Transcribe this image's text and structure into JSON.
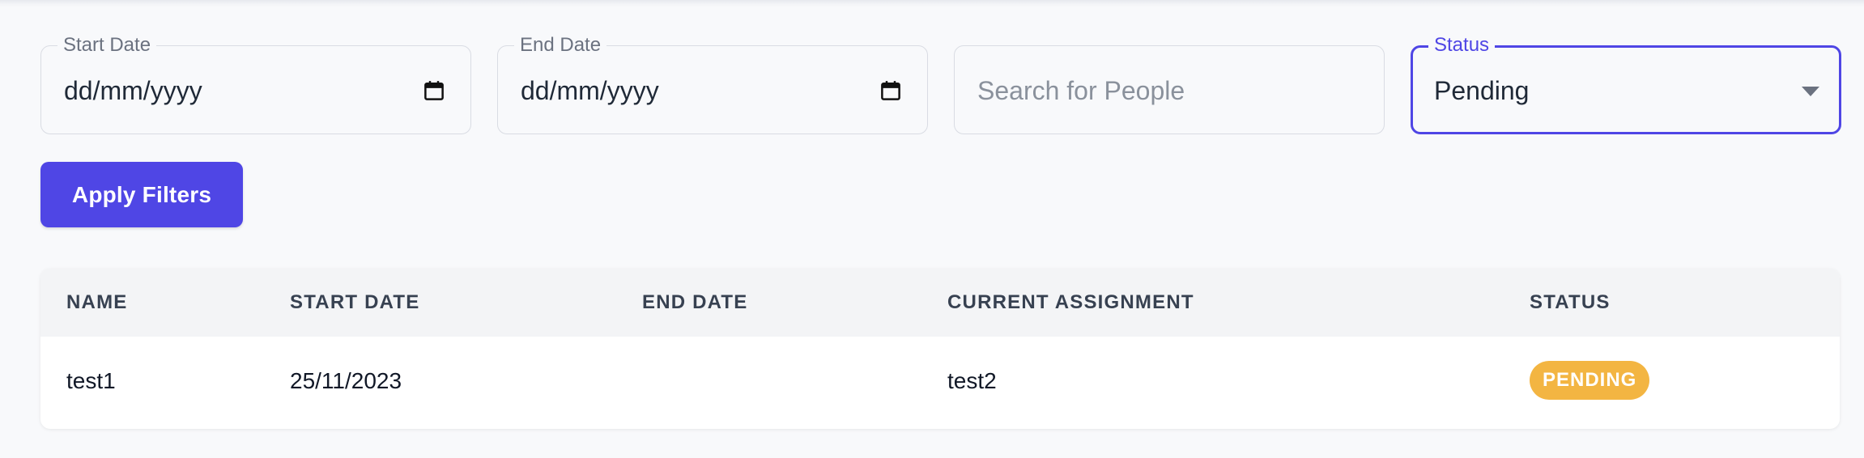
{
  "filters": {
    "start_date": {
      "label": "Start Date",
      "value": "dd/mm/yyyy"
    },
    "end_date": {
      "label": "End Date",
      "value": "dd/mm/yyyy"
    },
    "search": {
      "placeholder": "Search for People"
    },
    "status": {
      "label": "Status",
      "value": "Pending"
    }
  },
  "apply_button": {
    "label": "Apply Filters"
  },
  "table": {
    "columns": [
      "NAME",
      "START DATE",
      "END DATE",
      "CURRENT ASSIGNMENT",
      "STATUS"
    ],
    "rows": [
      {
        "name": "test1",
        "start_date": "25/11/2023",
        "end_date": "",
        "assignment": "test2",
        "status": "PENDING"
      }
    ]
  },
  "colors": {
    "accent": "#4f46e5",
    "status_pending": "#f3b542",
    "background": "#f8f9fb"
  },
  "icons": {
    "date_picker": "calendar-icon",
    "dropdown": "caret-down-icon"
  }
}
